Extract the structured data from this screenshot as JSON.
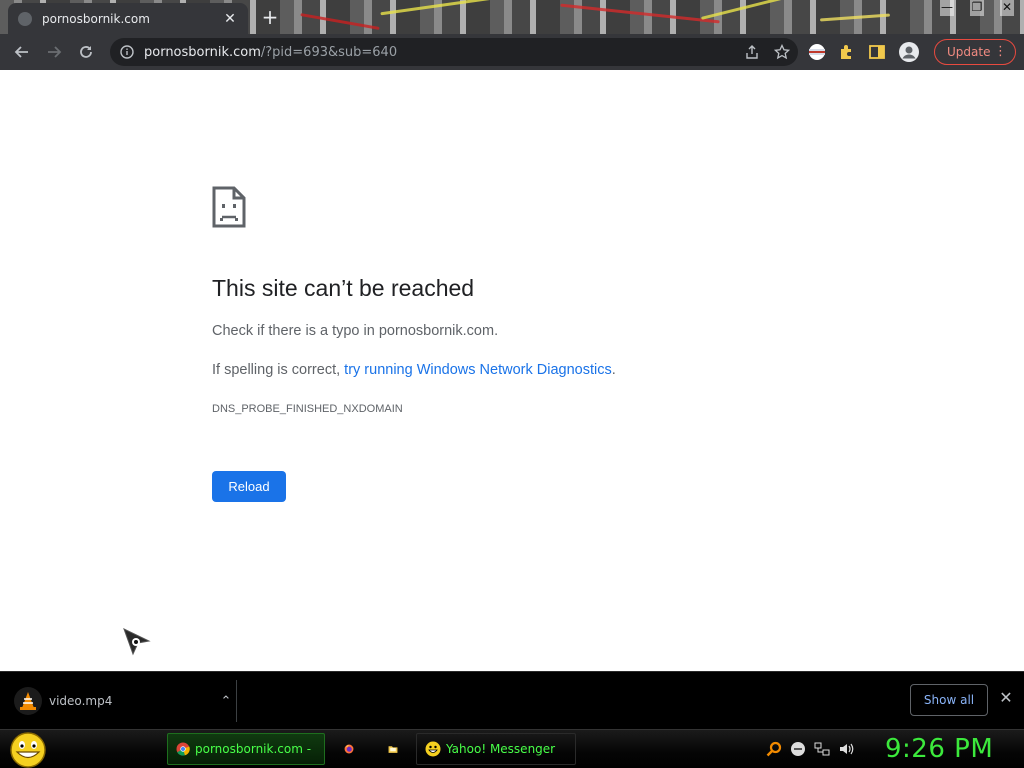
{
  "browser": {
    "tab_title": "pornosbornik.com",
    "tab_close": "✕",
    "new_tab": "+",
    "window_controls": [
      "—",
      "❐",
      "✕"
    ],
    "url_host": "pornosbornik.com",
    "url_rest": "/?pid=693&sub=640",
    "update_label": "Update",
    "menu_glyph": "⋮"
  },
  "error_page": {
    "title": "This site can’t be reached",
    "line1": "Check if there is a typo in pornosbornik.com.",
    "line2_prefix": "If spelling is correct, ",
    "line2_link": "try running Windows Network Diagnostics",
    "line2_suffix": ".",
    "code": "DNS_PROBE_FINISHED_NXDOMAIN",
    "reload_label": "Reload"
  },
  "download_shelf": {
    "item_name": "video.mp4",
    "chevron": "⌃",
    "show_all_label": "Show all",
    "close_glyph": "✕"
  },
  "taskbar": {
    "chrome_label": "pornosbornik.com - ...",
    "yahoo_label": "Yahoo! Messenger",
    "clock": "9:26 PM"
  },
  "colors": {
    "chrome_dark": "#35363a",
    "omnibox": "#202124",
    "link_blue": "#1a73e8",
    "update_red": "#e84a3f",
    "taskbar_green": "#3ce93c"
  },
  "icons": {
    "back": "arrow-left-icon",
    "forward": "arrow-right-icon",
    "reload": "reload-icon",
    "info": "info-icon",
    "share": "share-icon",
    "star": "star-icon",
    "profile": "profile-flag-icon",
    "extensions": "puzzle-icon",
    "sidepanel": "side-panel-icon",
    "avatar": "avatar-icon",
    "error": "sad-document-icon",
    "vlc": "vlc-cone-icon"
  }
}
